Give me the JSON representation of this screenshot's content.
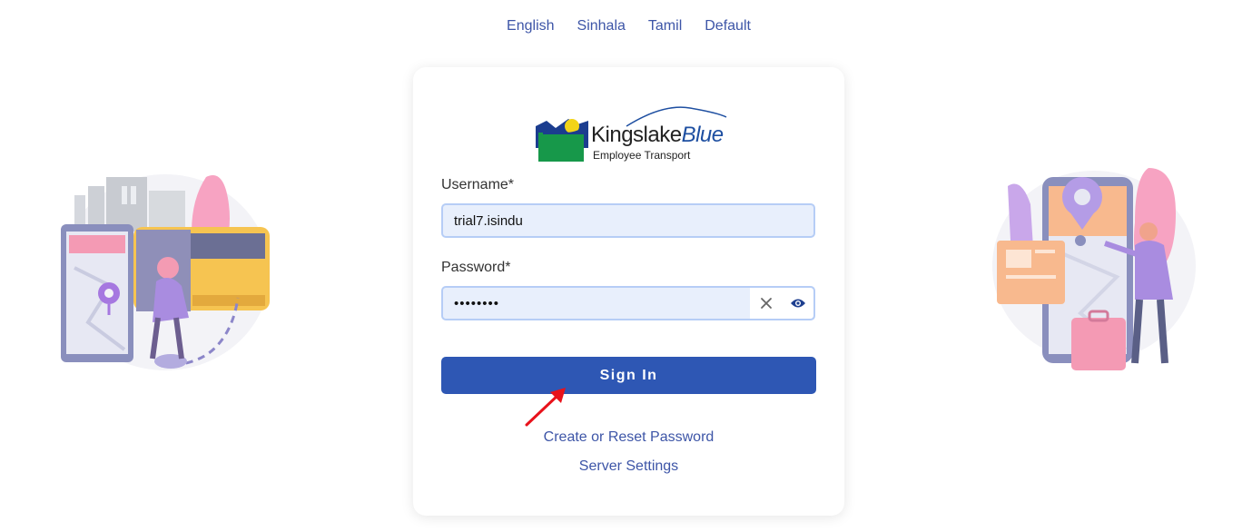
{
  "languages": [
    {
      "label": "English"
    },
    {
      "label": "Sinhala"
    },
    {
      "label": "Tamil"
    },
    {
      "label": "Default"
    }
  ],
  "logo": {
    "brand_main": "Kingslake",
    "brand_accent": "Blue",
    "tagline": "Employee Transport"
  },
  "form": {
    "username_label": "Username*",
    "username_value": "trial7.isindu",
    "password_label": "Password*",
    "password_value": "••••••••",
    "signin_label": "Sign In"
  },
  "links": {
    "reset_password": "Create or Reset Password",
    "server_settings": "Server Settings"
  },
  "icons": {
    "clear": "close-icon",
    "reveal": "eye-icon"
  },
  "colors": {
    "accent": "#2e57b4",
    "link": "#3d55a7",
    "input_bg": "#e8effc"
  }
}
